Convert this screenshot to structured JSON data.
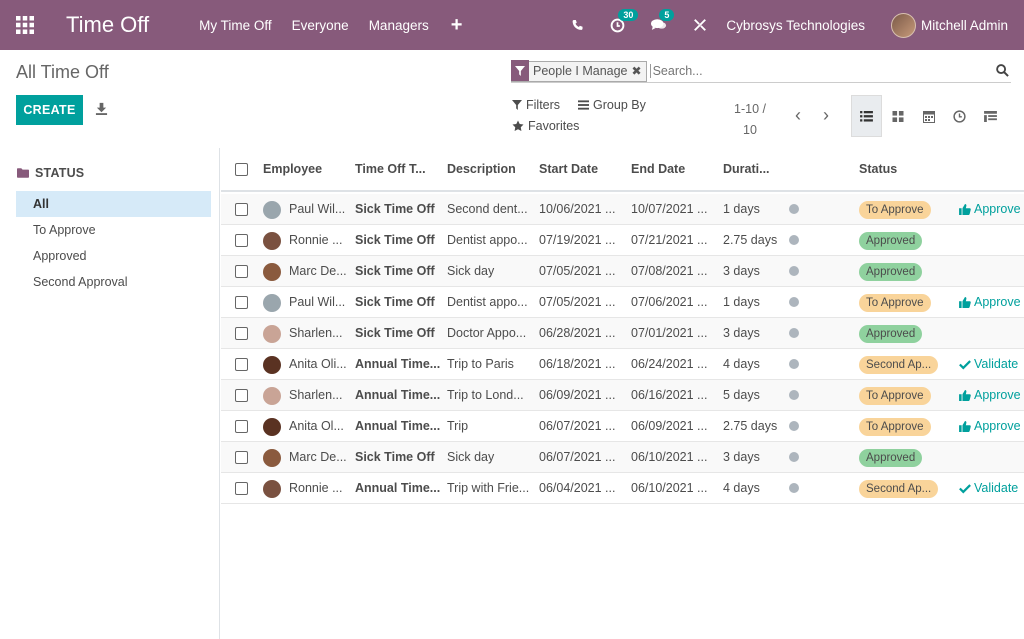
{
  "navbar": {
    "app_title": "Time Off",
    "menu": [
      "My Time Off",
      "Everyone",
      "Managers"
    ],
    "plus": "+",
    "activity_count": "30",
    "messages_count": "5",
    "company": "Cybrosys Technologies",
    "user": "Mitchell Admin"
  },
  "control": {
    "breadcrumb": "All Time Off",
    "create_label": "CREATE",
    "facet_label": "People I Manage",
    "search_placeholder": "Search...",
    "filters_label": "Filters",
    "groupby_label": "Group By",
    "favorites_label": "Favorites",
    "pager_line1": "1-10 /",
    "pager_line2": "10",
    "active_view": "list"
  },
  "sidebar": {
    "title": "STATUS",
    "items": [
      "All",
      "To Approve",
      "Approved",
      "Second Approval"
    ],
    "active_index": 0
  },
  "table": {
    "headers": [
      "Employee",
      "Time Off T...",
      "Description",
      "Start Date",
      "End Date",
      "Durati...",
      "Status"
    ],
    "rows": [
      {
        "employee": "Paul Wil...",
        "type": "Sick Time Off",
        "description": "Second dent...",
        "start": "10/06/2021 ...",
        "end": "10/07/2021 ...",
        "duration": "1 days",
        "status": "To Approve",
        "status_kind": "approve",
        "action": "Approve",
        "avatar": "#9aa6ad"
      },
      {
        "employee": "Ronnie ...",
        "type": "Sick Time Off",
        "description": "Dentist appo...",
        "start": "07/19/2021 ...",
        "end": "07/21/2021 ...",
        "duration": "2.75 days",
        "status": "Approved",
        "status_kind": "approved",
        "action": "",
        "avatar": "#7a5140"
      },
      {
        "employee": "Marc De...",
        "type": "Sick Time Off",
        "description": "Sick day",
        "start": "07/05/2021 ...",
        "end": "07/08/2021 ...",
        "duration": "3 days",
        "status": "Approved",
        "status_kind": "approved",
        "action": "",
        "avatar": "#8a5a3e"
      },
      {
        "employee": "Paul Wil...",
        "type": "Sick Time Off",
        "description": "Dentist appo...",
        "start": "07/05/2021 ...",
        "end": "07/06/2021 ...",
        "duration": "1 days",
        "status": "To Approve",
        "status_kind": "approve",
        "action": "Approve",
        "avatar": "#9aa6ad"
      },
      {
        "employee": "Sharlen...",
        "type": "Sick Time Off",
        "description": "Doctor Appo...",
        "start": "06/28/2021 ...",
        "end": "07/01/2021 ...",
        "duration": "3 days",
        "status": "Approved",
        "status_kind": "approved",
        "action": "",
        "avatar": "#c9a496"
      },
      {
        "employee": "Anita Oli...",
        "type": "Annual Time...",
        "description": "Trip to Paris",
        "start": "06/18/2021 ...",
        "end": "06/24/2021 ...",
        "duration": "4 days",
        "status": "Second Ap...",
        "status_kind": "second",
        "action": "Validate",
        "avatar": "#5a3222"
      },
      {
        "employee": "Sharlen...",
        "type": "Annual Time...",
        "description": "Trip to Lond...",
        "start": "06/09/2021 ...",
        "end": "06/16/2021 ...",
        "duration": "5 days",
        "status": "To Approve",
        "status_kind": "approve",
        "action": "Approve",
        "avatar": "#c9a496"
      },
      {
        "employee": "Anita Ol...",
        "type": "Annual Time...",
        "description": "Trip",
        "start": "06/07/2021 ...",
        "end": "06/09/2021 ...",
        "duration": "2.75 days",
        "status": "To Approve",
        "status_kind": "approve",
        "action": "Approve",
        "avatar": "#5a3222"
      },
      {
        "employee": "Marc De...",
        "type": "Sick Time Off",
        "description": "Sick day",
        "start": "06/07/2021 ...",
        "end": "06/10/2021 ...",
        "duration": "3 days",
        "status": "Approved",
        "status_kind": "approved",
        "action": "",
        "avatar": "#8a5a3e"
      },
      {
        "employee": "Ronnie ...",
        "type": "Annual Time...",
        "description": "Trip with Frie...",
        "start": "06/04/2021 ...",
        "end": "06/10/2021 ...",
        "duration": "4 days",
        "status": "Second Ap...",
        "status_kind": "second",
        "action": "Validate",
        "avatar": "#7a5140"
      }
    ]
  },
  "colors": {
    "brand": "#875a7b",
    "accent": "#00a09d"
  }
}
